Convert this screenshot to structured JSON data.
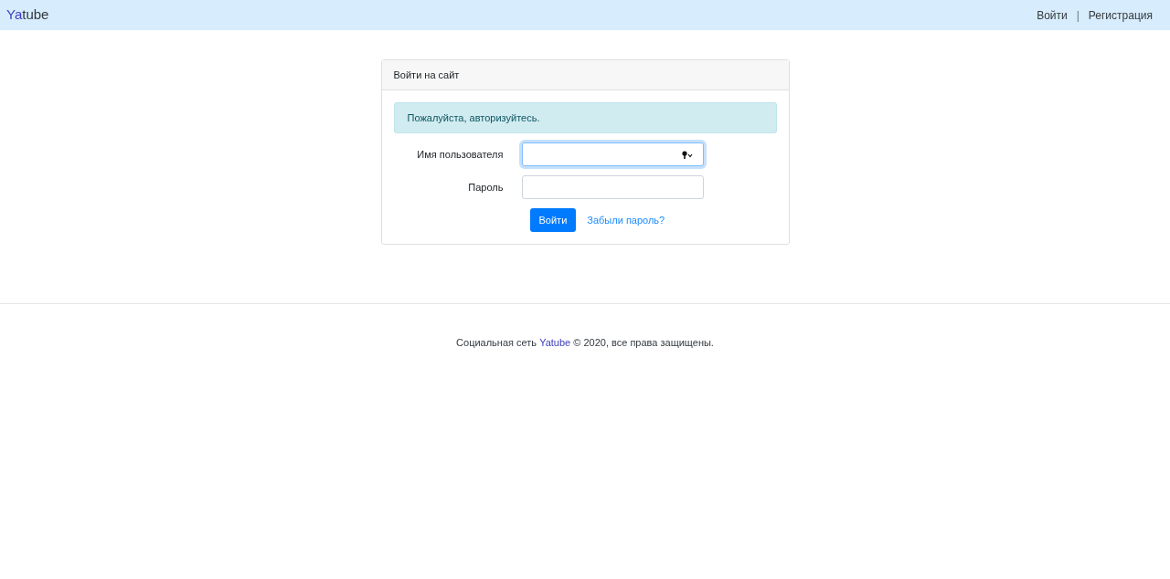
{
  "navbar": {
    "brand": [
      {
        "text": "Ya",
        "accent": true
      },
      {
        "text": "tube",
        "accent": false
      }
    ],
    "links": [
      {
        "kind": "link",
        "text": "Войти"
      },
      {
        "kind": "separator",
        "text": "|"
      },
      {
        "kind": "link",
        "text": "Регистрация"
      }
    ]
  },
  "card": {
    "title": "Войти на сайт",
    "alert": "Пожалуйста, авторизуйтесь.",
    "fields": [
      {
        "label": "Имя пользователя",
        "focused": true,
        "key_icon": true
      },
      {
        "label": "Пароль",
        "focused": false,
        "key_icon": false
      }
    ],
    "submit": "Войти",
    "forgot_link": "Забыли пароль?"
  },
  "footer": {
    "parts": [
      {
        "text": "Социальная сеть ",
        "accent": false
      },
      {
        "text": "Yatube",
        "accent": true
      },
      {
        "text": " © 2020, все права защищены.",
        "accent": false
      }
    ]
  }
}
